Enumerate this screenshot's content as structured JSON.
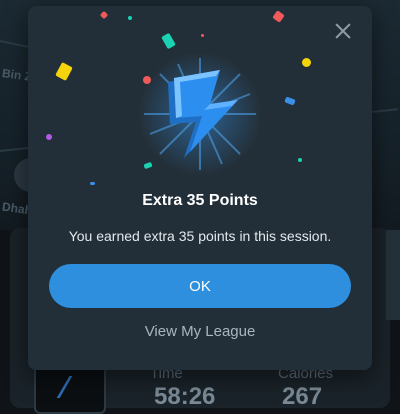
{
  "background": {
    "map_labels": [
      "Bin Z",
      "Dhahe"
    ],
    "stats": [
      {
        "label": "Time",
        "value": "58:26"
      },
      {
        "label": "Calories",
        "value": "267"
      }
    ]
  },
  "modal": {
    "icon": "lightning-bolt-icon",
    "title": "Extra 35 Points",
    "message": "You earned extra 35 points in this session.",
    "ok_label": "OK",
    "league_link": "View My League",
    "close_icon": "close-icon"
  },
  "colors": {
    "modal_bg": "#232f38",
    "primary_button": "#2f8fdf",
    "bolt_blue": "#2c8ff0"
  }
}
